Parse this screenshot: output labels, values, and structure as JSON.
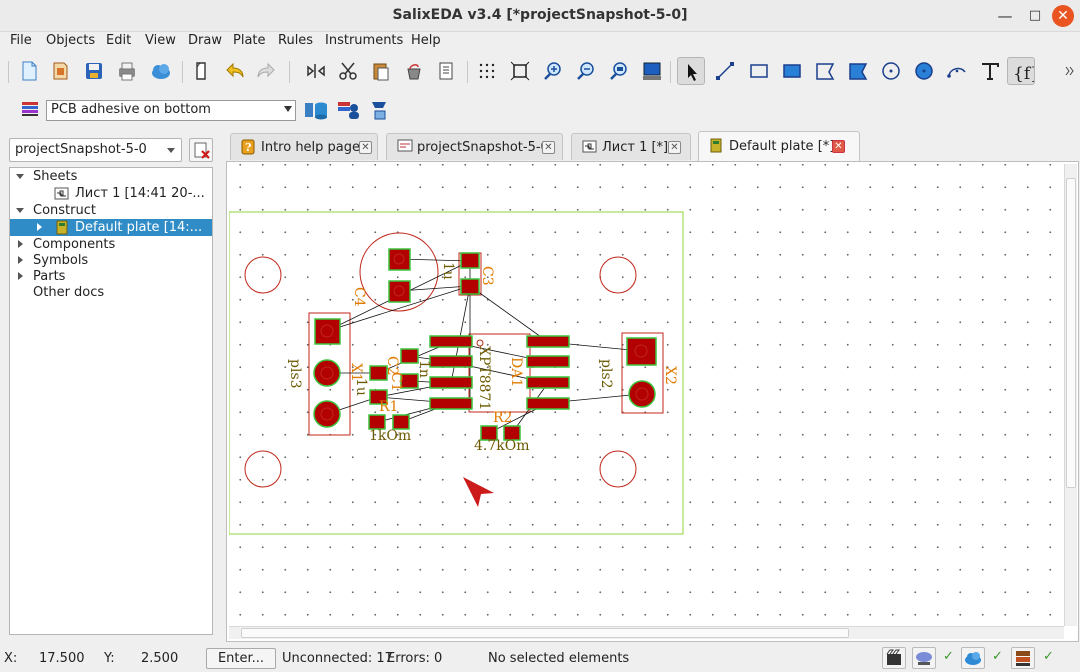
{
  "window": {
    "title": "SalixEDA v3.4 [*projectSnapshot-5-0]"
  },
  "menu": [
    "File",
    "Objects",
    "Edit",
    "View",
    "Draw",
    "Plate",
    "Rules",
    "Instruments",
    "Help"
  ],
  "toolbar": {
    "buttons": [
      "new-file-icon",
      "open-file-icon",
      "save-icon",
      "print-icon",
      "cloud-icon",
      "new-page-icon",
      "undo-icon",
      "redo-icon",
      "mirror-icon",
      "cut-icon",
      "paste-icon",
      "clean-icon",
      "document-icon",
      "grid-icon",
      "fit-icon",
      "zoom-in-icon",
      "zoom-out-icon",
      "zoom-area-icon",
      "monitor-icon",
      "select-icon",
      "line-icon",
      "rect-icon",
      "filled-rect-icon",
      "polygon-icon",
      "filled-polygon-icon",
      "circle-icon",
      "filled-circle-icon",
      "arc-icon",
      "text-icon",
      "function-icon",
      "more-icon"
    ]
  },
  "layer": {
    "selected": "PCB adhesive on bottom"
  },
  "project": {
    "selected": "projectSnapshot-5-0"
  },
  "tree": {
    "sheets": "Sheets",
    "sheet_item": "Лист 1 [14:41 20-...",
    "construct": "Construct",
    "plate_item": "Default plate [14:...",
    "components": "Components",
    "symbols": "Symbols",
    "parts": "Parts",
    "other": "Other docs"
  },
  "tabs": [
    {
      "label": "Intro help page"
    },
    {
      "label": "projectSnapshot-5-0"
    },
    {
      "label": "Лист 1 [*]"
    },
    {
      "label": "Default plate [*]",
      "active": true
    }
  ],
  "board": {
    "labels": {
      "c4": "C4",
      "c3": "C3",
      "c3_value": "1u",
      "c2": "C2",
      "c2_value": "1n",
      "c1": "C1",
      "c1_value": "1u",
      "da1": "DA1",
      "chip": "XPT8871",
      "x1": "X1",
      "pls3": "pls3",
      "pls2": "pls2",
      "x2": "X2",
      "r1": "R1",
      "r1_value": "1kOm",
      "r2": "R2",
      "r2_value": "4.7kOm"
    },
    "colors": {
      "outline": "#8fd43a",
      "pad": "#b30000",
      "pad_stroke": "#3cc43c",
      "silk": "#c0271a",
      "designator": "#e07b00",
      "value": "#6b5a00",
      "cursor": "#cc1a1a"
    }
  },
  "status": {
    "x_label": "X:",
    "x_value": "17.500",
    "y_label": "Y:",
    "y_value": "2.500",
    "enter": "Enter...",
    "unconnected": "Unconnected: 17",
    "errors": "Errors: 0",
    "selection": "No selected elements"
  }
}
